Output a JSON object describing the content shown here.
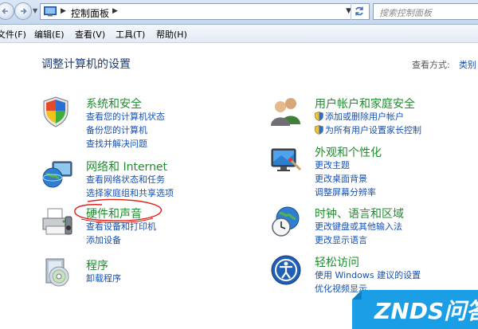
{
  "address_bar": {
    "path": "控制面板",
    "search_placeholder": "搜索控制面板"
  },
  "menu": [
    "文件(F)",
    "编辑(E)",
    "查看(V)",
    "工具(T)",
    "帮助(H)"
  ],
  "header": {
    "title": "调整计算机的设置",
    "view_label": "查看方式:",
    "view_value": "类别"
  },
  "categories": [
    {
      "title": "系统和安全",
      "links": [
        "查看您的计算机状态",
        "备份您的计算机",
        "查找并解决问题"
      ]
    },
    {
      "title": "网络和 Internet",
      "links": [
        "查看网络状态和任务",
        "选择家庭组和共享选项"
      ]
    },
    {
      "title": "硬件和声音",
      "links": [
        "查看设备和打印机",
        "添加设备"
      ]
    },
    {
      "title": "程序",
      "links": [
        "卸载程序"
      ]
    },
    {
      "title": "用户帐户和家庭安全",
      "links": [
        "添加或删除用户帐户",
        "为所有用户设置家长控制"
      ]
    },
    {
      "title": "外观和个性化",
      "links": [
        "更改主题",
        "更改桌面背景",
        "调整屏幕分辨率"
      ]
    },
    {
      "title": "时钟、语言和区域",
      "links": [
        "更改键盘或其他输入法",
        "更改显示语言"
      ]
    },
    {
      "title": "轻松访问",
      "links": [
        "使用 Windows 建议的设置",
        "优化视频显示"
      ]
    }
  ],
  "watermark": {
    "text": "ZNDS问答"
  },
  "colors": {
    "link": "#1550b4",
    "category_title": "#1f8b2f",
    "title": "#1a3c7a",
    "annotation": "#e0201a"
  }
}
